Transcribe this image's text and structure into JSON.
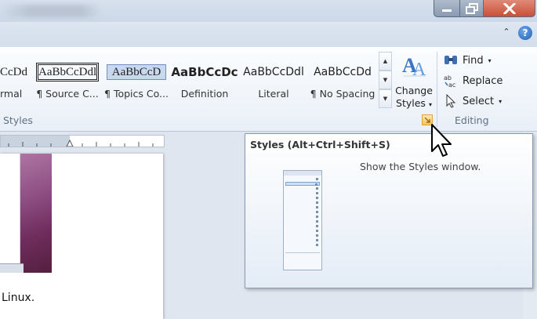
{
  "window": {
    "minimize_icon": "minimize-icon",
    "maximize_icon": "restore-icon",
    "close_icon": "close-icon"
  },
  "ribbon": {
    "help_icon_glyph": "?",
    "collapse_glyph": "⌃",
    "styles_gallery": [
      {
        "sample": "CcDd",
        "name": "rmal"
      },
      {
        "sample": "AaBbCcDdl",
        "name": "¶ Source C..."
      },
      {
        "sample": "AaBbCcD",
        "name": "¶ Topics Co..."
      },
      {
        "sample": "AaBbCcDc",
        "name": "Definition"
      },
      {
        "sample": "AaBbCcDdl",
        "name": "Literal"
      },
      {
        "sample": "AaBbCcDd",
        "name": "¶ No Spacing"
      }
    ],
    "change_styles": {
      "label_line1": "Change",
      "label_line2": "Styles"
    },
    "editing": {
      "find": "Find",
      "replace": "Replace",
      "select": "Select",
      "group_label": "Editing"
    },
    "styles_group_label": "Styles"
  },
  "document": {
    "text": "Linux."
  },
  "tooltip": {
    "title": "Styles (Alt+Ctrl+Shift+S)",
    "description": "Show the Styles window."
  },
  "colors": {
    "accent": "#1f5fb5",
    "launcher": "#f7c258",
    "close": "#c84f37"
  }
}
